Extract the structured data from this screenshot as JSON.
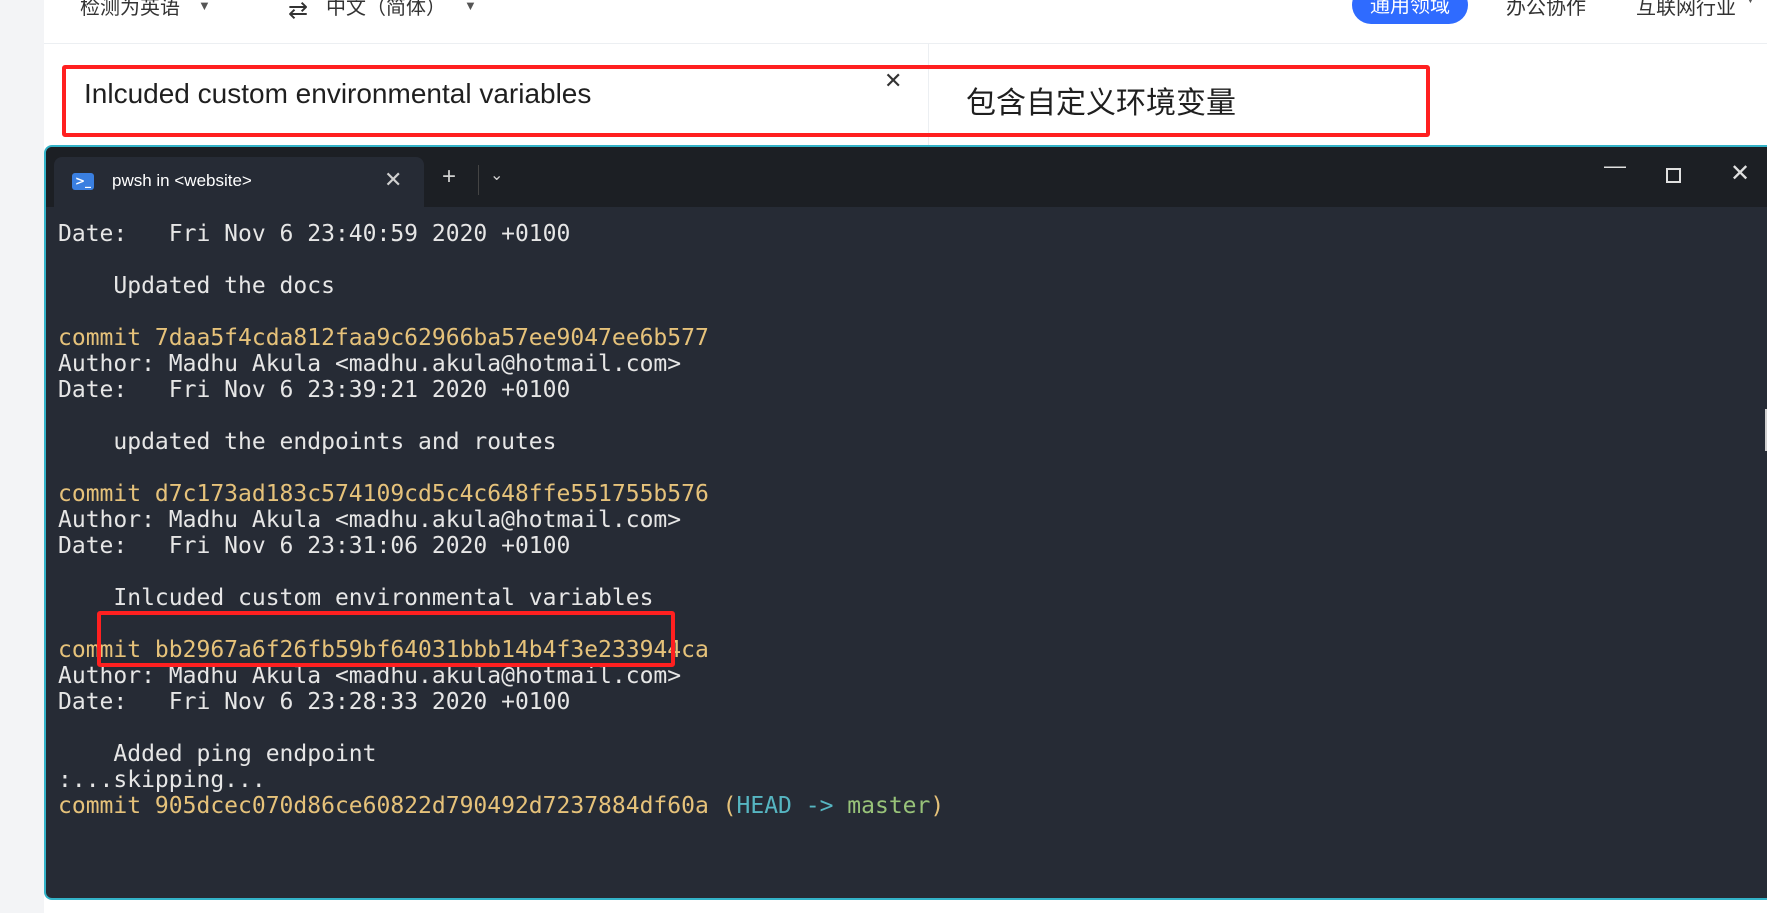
{
  "translator": {
    "source_lang": "检测为英语",
    "target_lang": "中文（简体）",
    "domains": [
      "通用领域",
      "办公协作",
      "互联网行业"
    ],
    "source_text": "Inlcuded custom environmental variables",
    "target_text": "包含自定义环境变量"
  },
  "terminal": {
    "tab_title": "pwsh in <website>",
    "lines": {
      "l1": "Date:   Fri Nov 6 23:40:59 2020 +0100",
      "l2": "    Updated the docs",
      "c1": "commit 7daa5f4cda812faa9c62966ba57ee9047ee6b577",
      "a1": "Author: Madhu Akula <madhu.akula@hotmail.com>",
      "d1": "Date:   Fri Nov 6 23:39:21 2020 +0100",
      "m1": "    updated the endpoints and routes",
      "c2": "commit d7c173ad183c574109cd5c4c648ffe551755b576",
      "a2": "Author: Madhu Akula <madhu.akula@hotmail.com>",
      "d2": "Date:   Fri Nov 6 23:31:06 2020 +0100",
      "m2": "    Inlcuded custom environmental variables",
      "c3": "commit bb2967a6f26fb59bf64031bbb14b4f3e233944ca",
      "a3": "Author: Madhu Akula <madhu.akula@hotmail.com>",
      "d3": "Date:   Fri Nov 6 23:28:33 2020 +0100",
      "m3": "    Added ping endpoint",
      "skip": ":...skipping...",
      "c4_prefix": "commit 905dcec070d86ce60822d790492d7237884df60a (",
      "c4_head": "HEAD -> ",
      "c4_branch": "master",
      "c4_suffix": ")"
    }
  },
  "colors": {
    "commit": "#e6c27a",
    "head": "#56b6c2",
    "branch": "#98c379",
    "highlight": "#ff2020",
    "accent": "#2f6bff"
  }
}
